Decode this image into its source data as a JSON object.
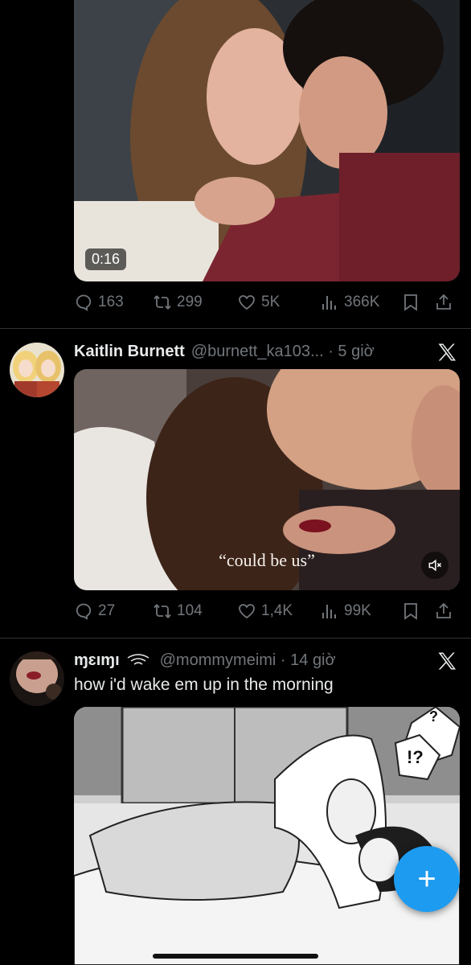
{
  "tweet1": {
    "video_duration": "0:16",
    "actions": {
      "replies": "163",
      "retweets": "299",
      "likes": "5K",
      "views": "366K"
    }
  },
  "tweet2": {
    "author_name": "Kaitlin Burnett",
    "handle_time": "@burnett_ka103... · 5 giờ",
    "caption": "“could be us”",
    "actions": {
      "replies": "27",
      "retweets": "104",
      "likes": "1,4K",
      "views": "99K"
    }
  },
  "tweet3": {
    "author_name": "ɱɛıɱı",
    "handle_time": "@mommymeimi · 14 giờ",
    "text": "how i'd wake em up in the morning",
    "manga_bubble_1": "?",
    "manga_bubble_2": "!?"
  },
  "fab": {
    "label": "+"
  },
  "colors": {
    "background": "#000000",
    "muted": "#71767b",
    "text": "#e7e9ea",
    "accent": "#1d9bf0"
  }
}
